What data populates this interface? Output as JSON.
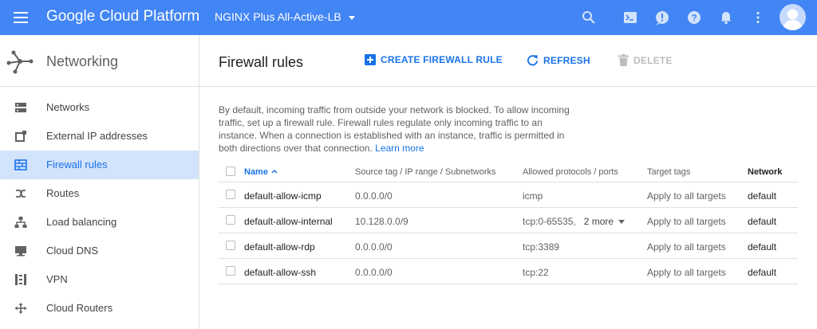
{
  "topbar": {
    "brand": "Google Cloud Platform",
    "project": "NGINX Plus All-Active-LB",
    "icons": [
      "search-icon",
      "cloud-shell-icon",
      "alert-icon",
      "help-icon",
      "notifications-icon",
      "more-vert-icon",
      "account-avatar"
    ],
    "color": "#4285f4"
  },
  "sidebar": {
    "title": "Networking",
    "items": [
      {
        "label": "Networks",
        "icon": "networks-icon"
      },
      {
        "label": "External IP addresses",
        "icon": "external-ip-icon"
      },
      {
        "label": "Firewall rules",
        "icon": "firewall-icon",
        "active": true
      },
      {
        "label": "Routes",
        "icon": "routes-icon"
      },
      {
        "label": "Load balancing",
        "icon": "load-balancing-icon"
      },
      {
        "label": "Cloud DNS",
        "icon": "cloud-dns-icon"
      },
      {
        "label": "VPN",
        "icon": "vpn-icon"
      },
      {
        "label": "Cloud Routers",
        "icon": "cloud-routers-icon"
      }
    ]
  },
  "toolbar": {
    "title": "Firewall rules",
    "create_label": "CREATE FIREWALL RULE",
    "refresh_label": "REFRESH",
    "delete_label": "DELETE"
  },
  "description": {
    "text": "By default, incoming traffic from outside your network is blocked. To allow incoming traffic, set up a firewall rule. Firewall rules regulate only incoming traffic to an instance. When a connection is established with an instance, traffic is permitted in both directions over that connection.",
    "link": "Learn more"
  },
  "table": {
    "columns": {
      "name": "Name",
      "source": "Source tag / IP range / Subnetworks",
      "protocols": "Allowed protocols / ports",
      "targets": "Target tags",
      "network": "Network"
    },
    "rows": [
      {
        "name": "default-allow-icmp",
        "source": "0.0.0.0/0",
        "protocols": "icmp",
        "more": "",
        "targets": "Apply to all targets",
        "network": "default"
      },
      {
        "name": "default-allow-internal",
        "source": "10.128.0.0/9",
        "protocols": "tcp:0-65535,",
        "more": "2 more",
        "targets": "Apply to all targets",
        "network": "default"
      },
      {
        "name": "default-allow-rdp",
        "source": "0.0.0.0/0",
        "protocols": "tcp:3389",
        "more": "",
        "targets": "Apply to all targets",
        "network": "default"
      },
      {
        "name": "default-allow-ssh",
        "source": "0.0.0.0/0",
        "protocols": "tcp:22",
        "more": "",
        "targets": "Apply to all targets",
        "network": "default"
      }
    ]
  },
  "colors": {
    "accent": "#1a73e8",
    "active_bg": "#d2e3fc"
  }
}
